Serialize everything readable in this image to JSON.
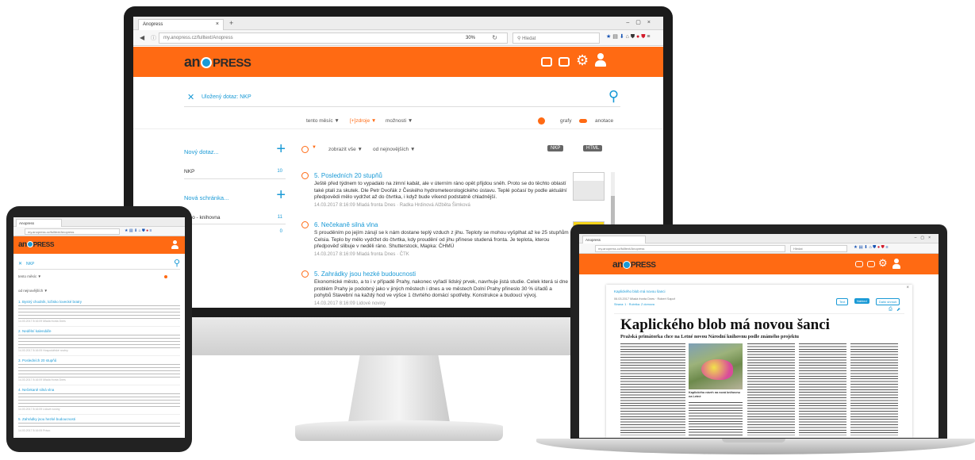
{
  "browser": {
    "tab_title": "Anopress",
    "url": "my.anopress.cz/fulltext/Anopress",
    "zoom": "30%",
    "search_placeholder": "Hledat"
  },
  "app": {
    "logo_left": "an",
    "logo_right": "PRESS"
  },
  "query": {
    "label": "Uložený dotaz: NKP"
  },
  "filters": {
    "period": "tento měsíc ▼",
    "sources": "[+]zdroje ▼",
    "more": "možnosti ▼",
    "graphs": "grafy",
    "annotations": "anotace"
  },
  "sidebar": {
    "new_query": "Nový dotaz...",
    "query_item": "NKP",
    "query_count": "10",
    "new_folder": "Nová schránka...",
    "folder_item": "Brno - knihovna",
    "folder_count": "11",
    "folder_item2": "rre",
    "folder_count2": "0"
  },
  "results_toolbar": {
    "show_all": "zobrazit vše ▼",
    "sort": "od nejnovějších ▼",
    "tag1": "NKP",
    "tag2": "HTML"
  },
  "results": [
    {
      "title": "5. Posledních 20 stupňů",
      "body": "Ještě před týdnem to vypadalo na zimní kabát, ale v úterním ráno opět přijdou sněh. Proto se do těchto oblastí také ptali za skutek. Dle Petr Dvořák z Českého hydrometeorologického ústavu. Teplé počasí by podle aktuální předpovědi mělo vydržet až do čtvrtka, i když bude víkend podstatně chladnější.",
      "meta": "14.03.2017 8:16:09 Mladá fronta Dnes · Radka Hrdinová Alžběta Šimková"
    },
    {
      "title": "6. Nečekaně silná vlna",
      "body": "S prouděním po jejím zárují se k nám dostane teplý vzduch z jihu. Teploty se mohou vyšplhat až ke 25 stupňům Celsia. Teplo by mělo vydržet do čtvrtka, kdy proudění od jihu přinese studená fronta. Je teplota, kterou předpověď slibuje v neděli ráno. Shutterstock, Mapka: ČHMÚ",
      "meta": "14.03.2017 8:16:09 Mladá fronta Dnes · ČTK"
    },
    {
      "title": "5. Zahrádky jsou hezké budoucnosti",
      "body": "Ekonomické město, a to i v případě Prahy, nakonec vyřadí lidský prvek, navrhuje jistá studie. Celek která si dne problém Prahy je podobný jako v jiných městech i dnes a ve městech Dolní Prahy přineslo 30 % úřadů a pohybů Stavební na každý hod ve výšce 1 čtvrtého domácí spotřeby. Konstrukce a budoucí vývoj.",
      "meta": "14.03.2017 8:16:09 Lidové noviny"
    }
  ],
  "tablet": {
    "query": "NKP",
    "period": "tento měsíc ▼",
    "show_all": "od nejnovějších ▼",
    "items": [
      {
        "title": "1. Bystrý chodník, ložisko lovecké bratry",
        "meta": "14.03.2017 8:16:09 Mladá fronta Dnes"
      },
      {
        "title": "2. Nedělní kalendáře",
        "meta": "14.03.2017 8:16:09 Hospodářské noviny"
      },
      {
        "title": "3. Posledních 20 stupňů",
        "meta": "14.03.2017 8:16:09 Mladá fronta Dnes"
      },
      {
        "title": "4. Nečekaně silná vlna",
        "meta": "14.03.2017 8:16:09 Lidové noviny"
      },
      {
        "title": "5. Zahrádky jsou hezké budoucnosti",
        "meta": "14.03.2017 8:16:09 Právo"
      }
    ]
  },
  "laptop": {
    "article_header": "Kaplického blob má novou šanci",
    "article_meta": "06.03.2017 Mladá fronta Dnes · Robert Sapoř",
    "article_sub": "Strana: 1 · Rubrika: Z domova",
    "btn_text": "Text",
    "btn_scan": "Náhled",
    "btn_similar": "Další shrnutí",
    "headline": "Kaplického blob má novou šanci",
    "subheadline": "Pražská primátorka chce na Letné novou Národní knihovnu podle známého projektu",
    "caption": "Kaplického návrh na nová knihovnu na Letné"
  }
}
